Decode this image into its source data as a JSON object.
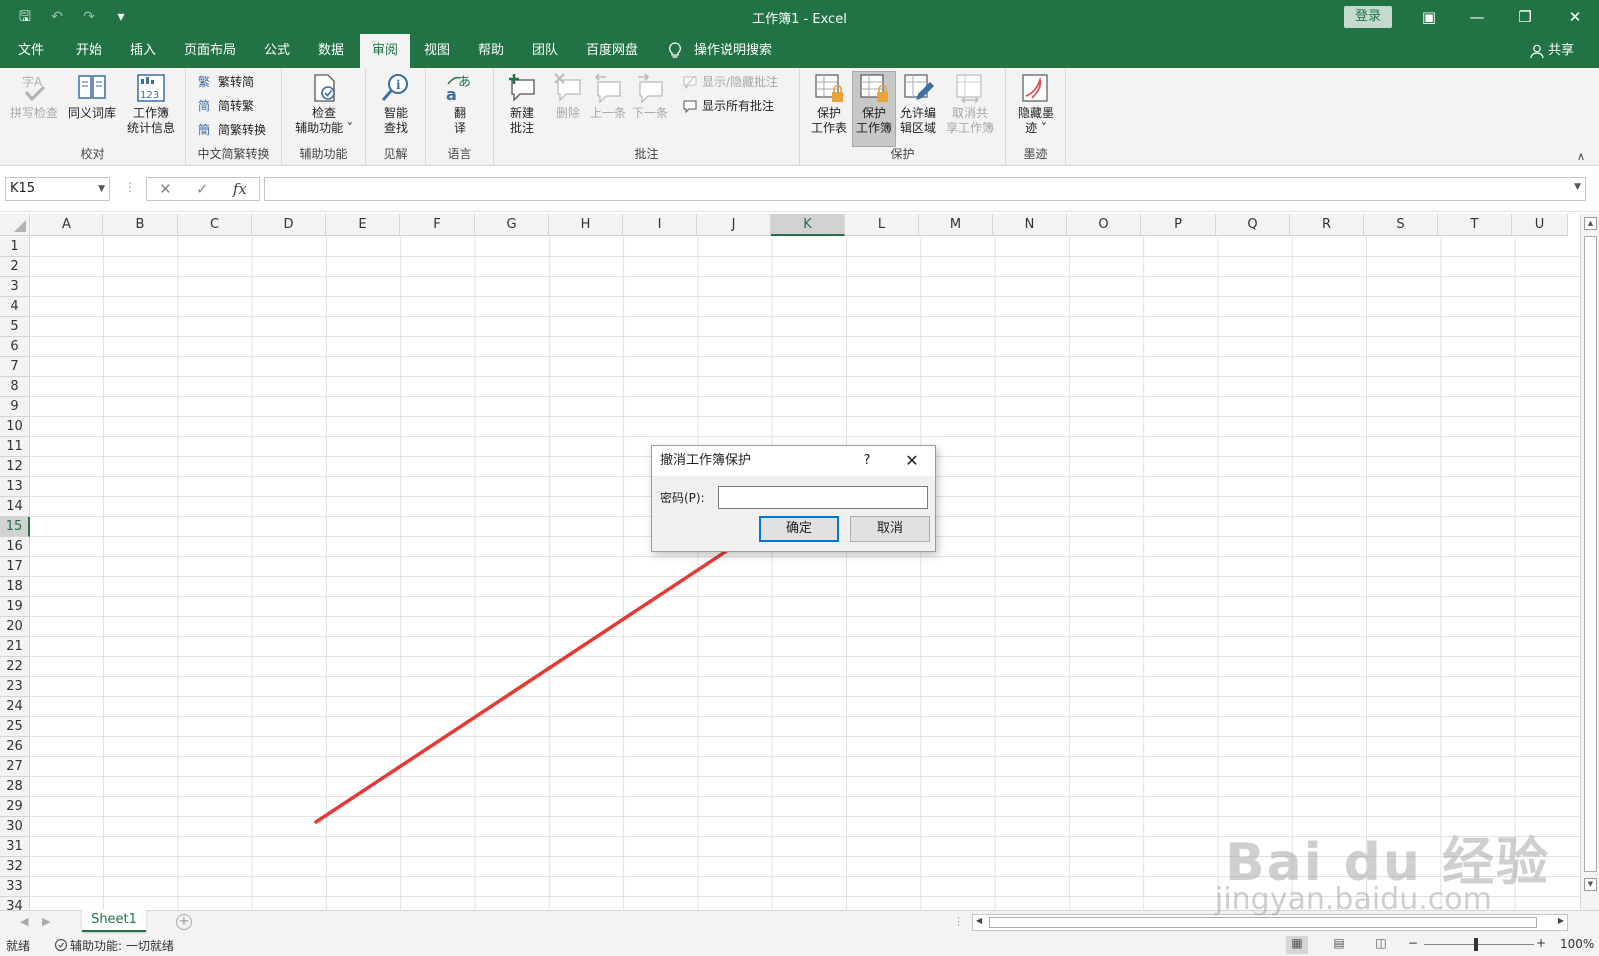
{
  "window": {
    "title": "工作簿1 - Excel",
    "login_label": "登录",
    "controls": {
      "ribbon_display": "▣",
      "minimize": "—",
      "restore": "❐",
      "close": "✕"
    }
  },
  "quick_access": {
    "save": "🖫",
    "undo": "↶",
    "redo": "↷",
    "customize": "▾"
  },
  "tabs": [
    {
      "label": "文件"
    },
    {
      "label": "开始"
    },
    {
      "label": "插入"
    },
    {
      "label": "页面布局"
    },
    {
      "label": "公式"
    },
    {
      "label": "数据"
    },
    {
      "label": "审阅",
      "active": true
    },
    {
      "label": "视图"
    },
    {
      "label": "帮助"
    },
    {
      "label": "团队"
    },
    {
      "label": "百度网盘"
    }
  ],
  "tell_me": {
    "label": "操作说明搜索"
  },
  "share_label": "共享",
  "ribbon": {
    "proofing": {
      "label": "校对",
      "spelling": "拼写检查",
      "thesaurus": "同义词库",
      "stats_line1": "工作簿",
      "stats_line2": "统计信息"
    },
    "chinese": {
      "label": "中文简繁转换",
      "to_simplified": "繁转简",
      "to_traditional": "简转繁",
      "convert": "简繁转换"
    },
    "accessibility": {
      "label": "辅助功能",
      "check_line1": "检查",
      "check_line2": "辅助功能"
    },
    "insights": {
      "label": "见解",
      "smart_line1": "智能",
      "smart_line2": "查找"
    },
    "language": {
      "label": "语言",
      "translate_line1": "翻",
      "translate_line2": "译"
    },
    "comments": {
      "label": "批注",
      "new_line1": "新建",
      "new_line2": "批注",
      "delete": "删除",
      "previous": "上一条",
      "next": "下一条",
      "show_hide": "显示/隐藏批注",
      "show_all": "显示所有批注"
    },
    "protect": {
      "label": "保护",
      "sheet_line1": "保护",
      "sheet_line2": "工作表",
      "workbook_line1": "保护",
      "workbook_line2": "工作簿",
      "allow_line1": "允许编",
      "allow_line2": "辑区域",
      "unshare_line1": "取消共",
      "unshare_line2": "享工作簿"
    },
    "ink": {
      "label": "墨迹",
      "hide_line1": "隐藏墨",
      "hide_line2": "迹"
    }
  },
  "formula_bar": {
    "name_box": "K15",
    "cancel": "✕",
    "enter": "✓",
    "fx": "fx",
    "value": ""
  },
  "grid": {
    "columns": [
      "A",
      "B",
      "C",
      "D",
      "E",
      "F",
      "G",
      "H",
      "I",
      "J",
      "K",
      "L",
      "M",
      "N",
      "O",
      "P",
      "Q",
      "R",
      "S",
      "T",
      "U"
    ],
    "rows": [
      "1",
      "2",
      "3",
      "4",
      "5",
      "6",
      "7",
      "8",
      "9",
      "10",
      "11",
      "12",
      "13",
      "14",
      "15",
      "16",
      "17",
      "18",
      "19",
      "20",
      "21",
      "22",
      "23",
      "24",
      "25",
      "26",
      "27",
      "28",
      "29",
      "30",
      "31",
      "32",
      "33",
      "34"
    ],
    "selected_column": "K",
    "selected_row": "15"
  },
  "sheets": [
    {
      "name": "Sheet1",
      "active": true
    }
  ],
  "add_sheet": "+",
  "status": {
    "ready": "就绪",
    "accessibility": "辅助功能: 一切就绪",
    "zoom_minus": "−",
    "zoom_plus": "+",
    "zoom": "100%",
    "zoom_level": 100
  },
  "dialog": {
    "title": "撤消工作簿保护",
    "help": "?",
    "close": "✕",
    "password_label": "密码(P):",
    "password_value": "",
    "ok": "确定",
    "cancel": "取消"
  },
  "watermark": {
    "main": "Bai du 经验",
    "url": "jingyan.baidu.com"
  },
  "colors": {
    "excel_green": "#217346",
    "arrow_red": "#e53935",
    "focus_blue": "#0078d7"
  }
}
